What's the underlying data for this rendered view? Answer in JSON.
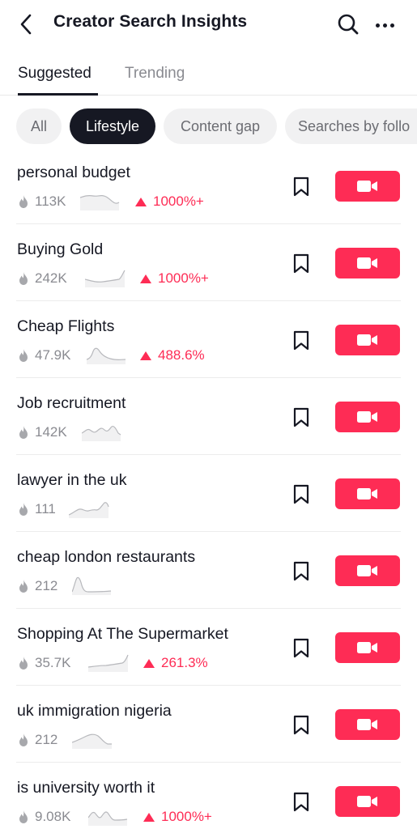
{
  "header": {
    "title": "Creator Search Insights",
    "back_icon": "chevron-left-icon",
    "search_icon": "search-icon",
    "more_icon": "more-horizontal-icon"
  },
  "tabs": [
    {
      "label": "Suggested",
      "active": true
    },
    {
      "label": "Trending",
      "active": false
    }
  ],
  "chips": [
    {
      "label": "All",
      "selected": false
    },
    {
      "label": "Lifestyle",
      "selected": true
    },
    {
      "label": "Content gap",
      "selected": false
    },
    {
      "label": "Searches by follo",
      "selected": false
    }
  ],
  "colors": {
    "accent": "#fe2c55",
    "text": "#161823",
    "muted": "#8a8b91",
    "chip_bg": "#f1f1f2"
  },
  "topics": [
    {
      "title": "personal budget",
      "views": "113K",
      "growth": "1000%+",
      "trend": "falling-wave"
    },
    {
      "title": "Buying Gold",
      "views": "242K",
      "growth": "1000%+",
      "trend": "rising-late"
    },
    {
      "title": "Cheap Flights",
      "views": "47.9K",
      "growth": "488.6%",
      "trend": "single-peak"
    },
    {
      "title": "Job recruitment",
      "views": "142K",
      "growth": "",
      "trend": "double-peak"
    },
    {
      "title": "lawyer in the uk",
      "views": "111",
      "growth": "",
      "trend": "rising-step"
    },
    {
      "title": "cheap london restaurants",
      "views": "212",
      "growth": "",
      "trend": "early-spike"
    },
    {
      "title": "Shopping At The Supermarket",
      "views": "35.7K",
      "growth": "261.3%",
      "trend": "rising-late"
    },
    {
      "title": "uk immigration nigeria",
      "views": "212",
      "growth": "",
      "trend": "hump"
    },
    {
      "title": "is university worth it",
      "views": "9.08K",
      "growth": "1000%+",
      "trend": "double-peak"
    }
  ]
}
